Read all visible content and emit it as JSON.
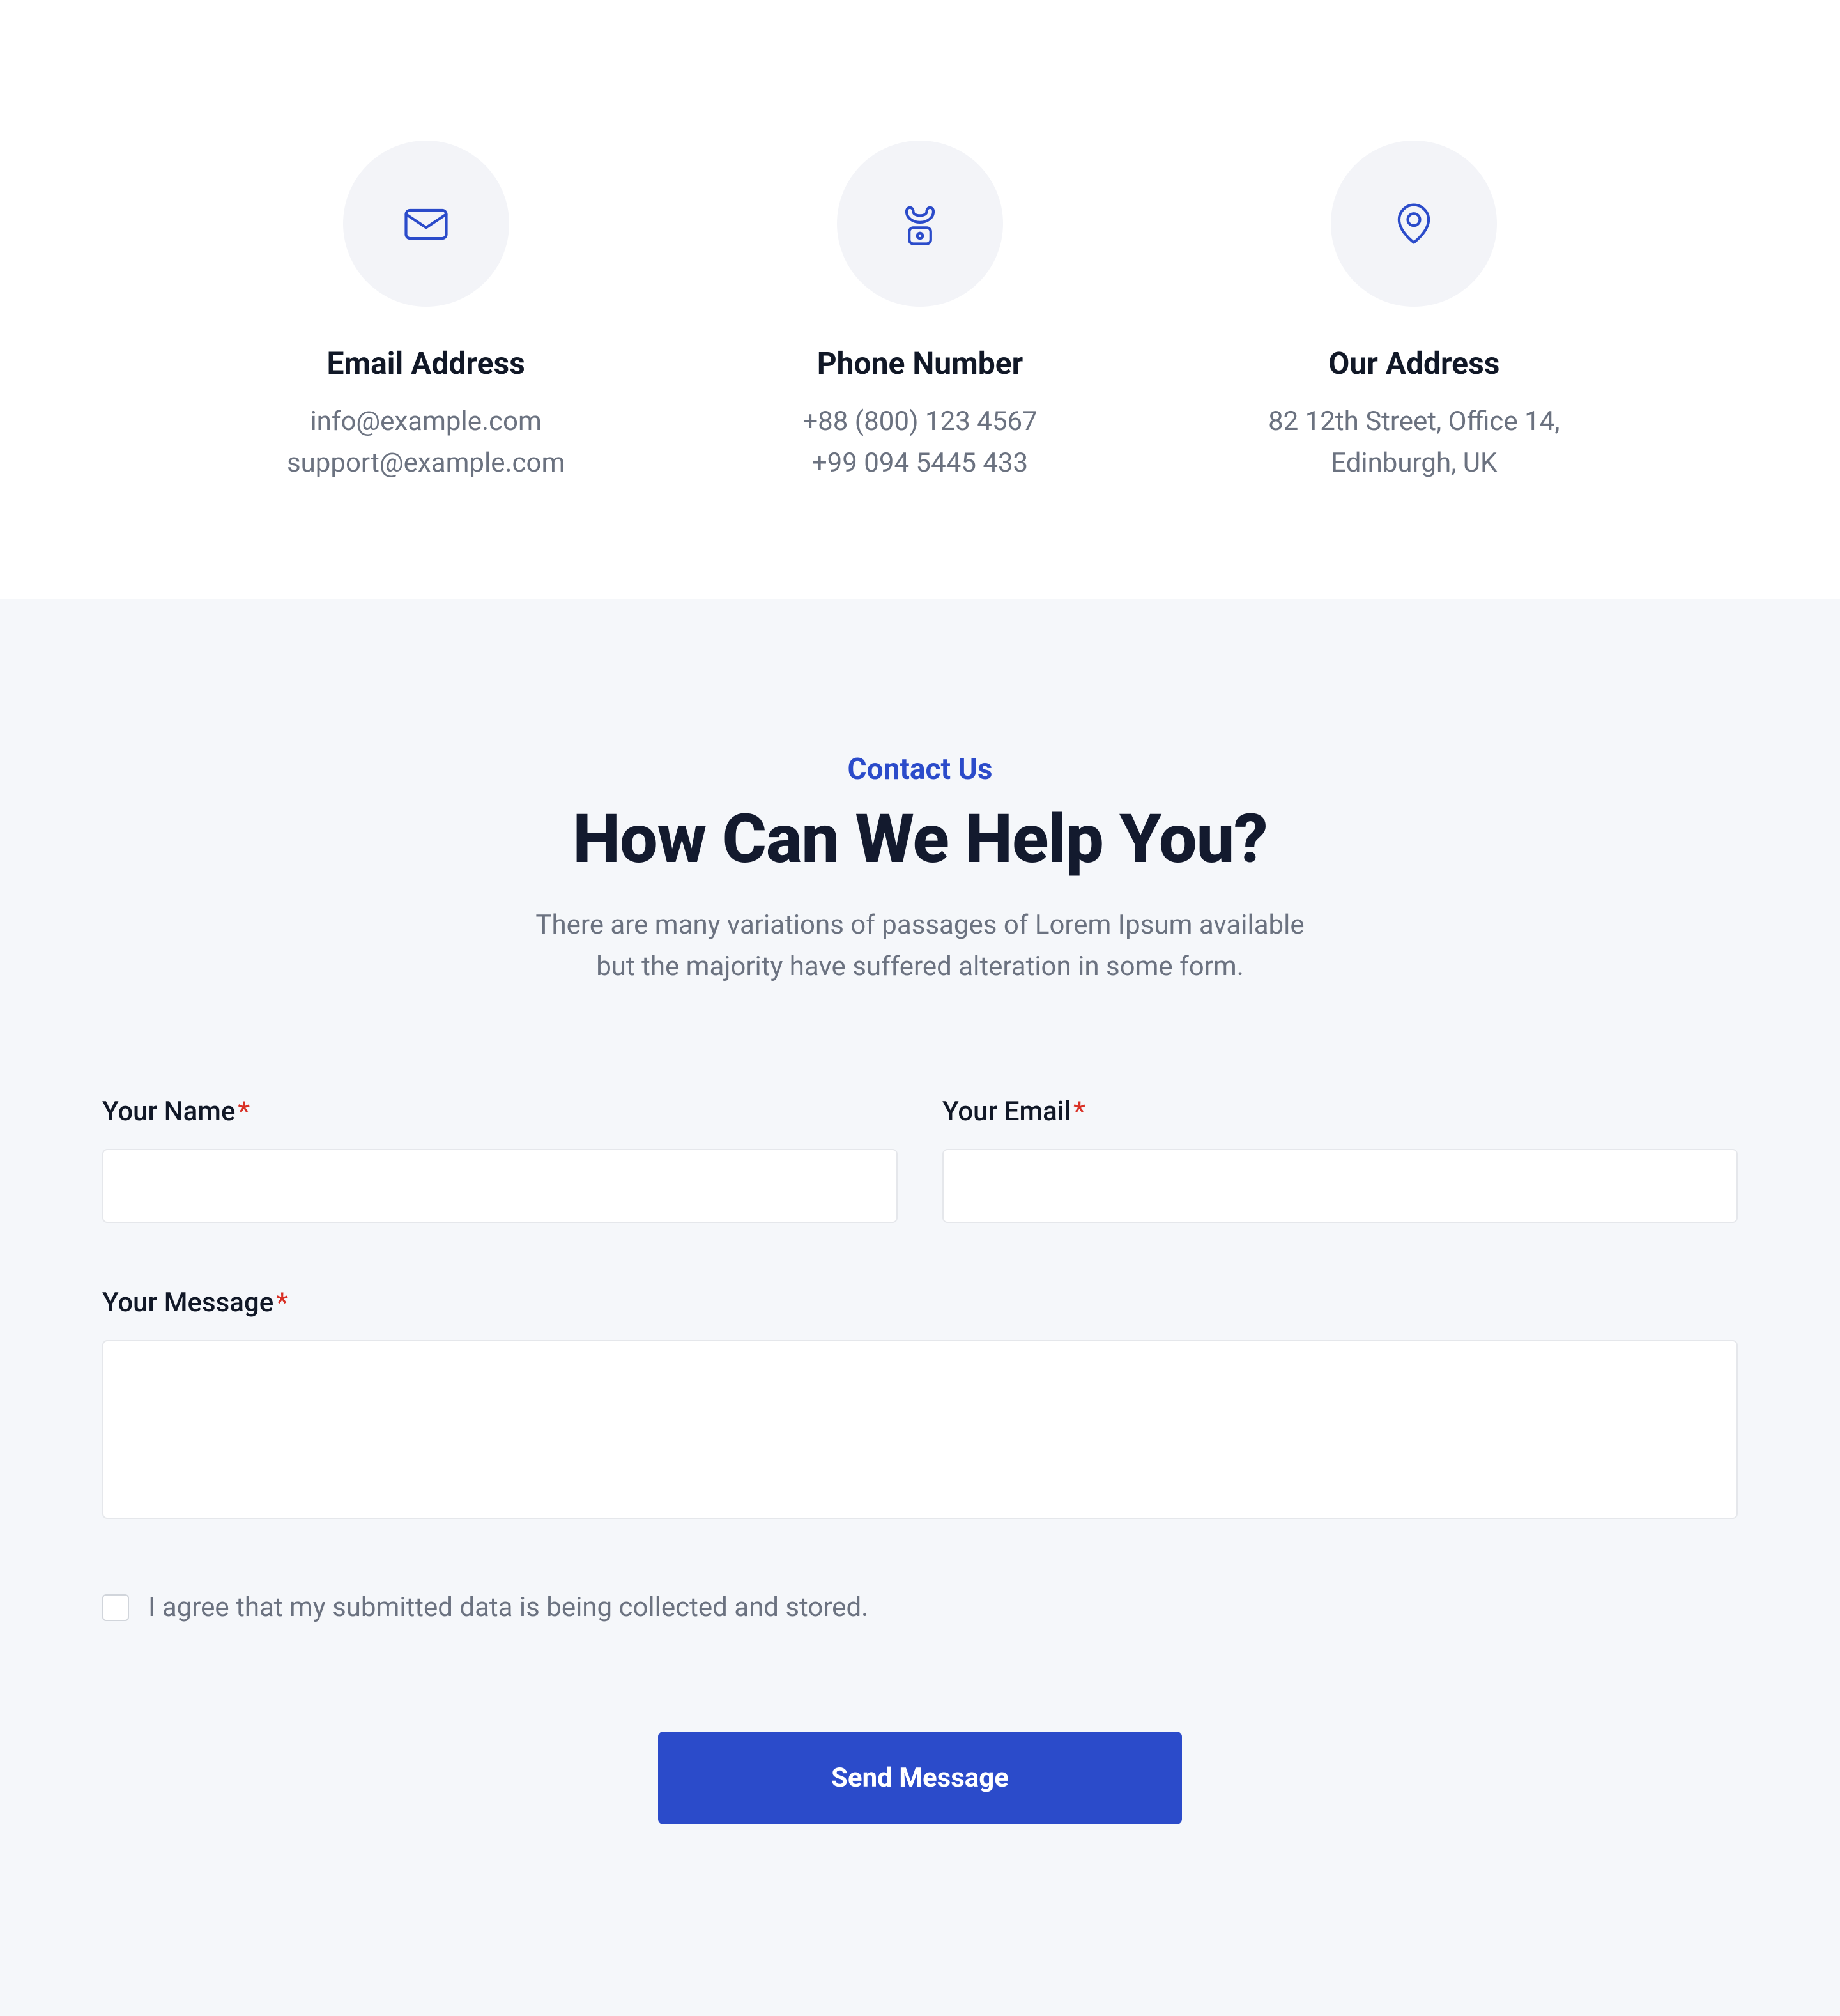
{
  "contact_cards": [
    {
      "title": "Email Address",
      "lines": [
        "info@example.com",
        "support@example.com"
      ]
    },
    {
      "title": "Phone Number",
      "lines": [
        "+88 (800) 123 4567",
        "+99 094 5445 433"
      ]
    },
    {
      "title": "Our Address",
      "lines": [
        "82 12th Street, Office 14,",
        "Edinburgh, UK"
      ]
    }
  ],
  "form_header": {
    "eyebrow": "Contact Us",
    "title": "How Can We Help You?",
    "lead": [
      "There are many variations of passages of Lorem Ipsum available",
      "but the majority have suffered alteration in some form."
    ]
  },
  "labels": {
    "name": "Your Name",
    "email": "Your Email",
    "message": "Your Message",
    "required": "*",
    "consent": "I agree that my submitted data is being collected and stored.",
    "submit": "Send Message"
  }
}
